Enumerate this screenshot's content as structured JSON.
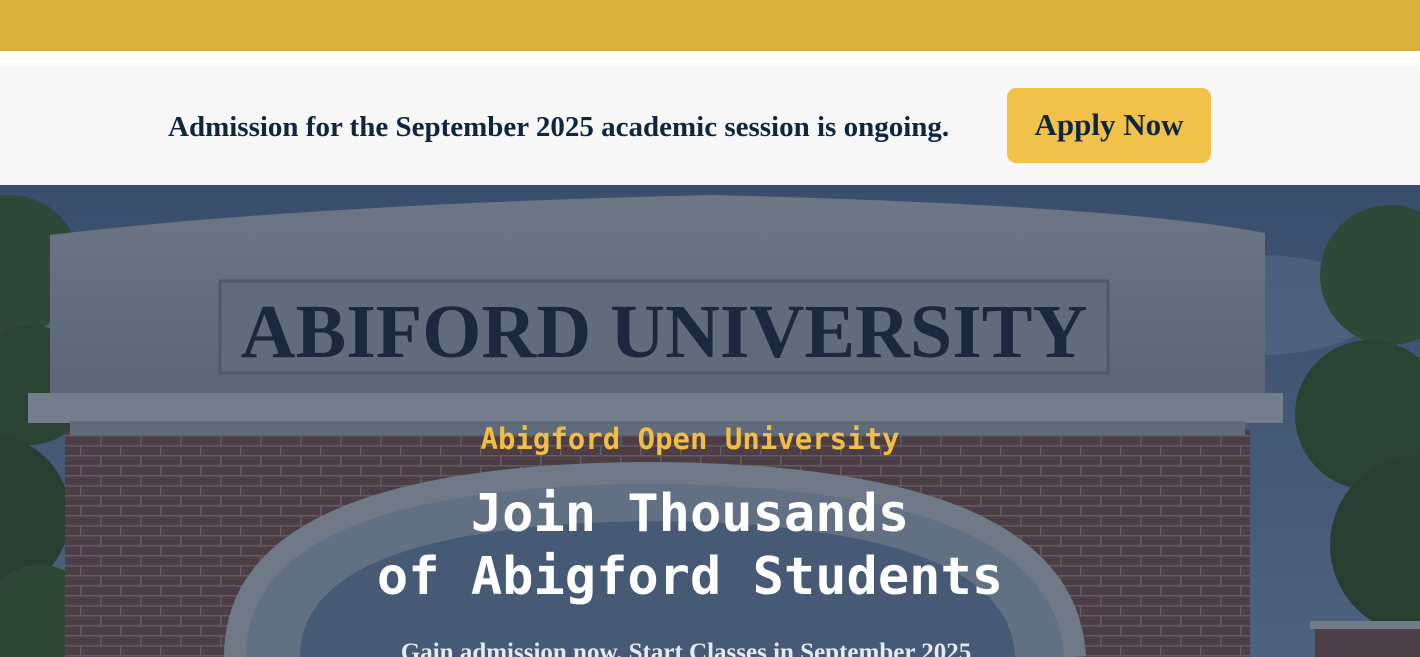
{
  "announcement": {
    "text": "Admission for the September 2025 academic session is ongoing.",
    "button_label": "Apply Now"
  },
  "hero": {
    "sign_text": "ABIFORD UNIVERSITY",
    "subtitle": "Abigford Open University",
    "title_line1": "Join Thousands",
    "title_line2": "of Abigford Students",
    "tagline": "Gain admission now. Start Classes in September 2025"
  },
  "colors": {
    "top_bar": "#d6b03a",
    "announce_bg": "#f7f7f7",
    "button_bg": "#f0c24a",
    "navy_text": "#0f2540",
    "hero_subtitle": "#f2bd45",
    "hero_title": "#ffffff"
  }
}
